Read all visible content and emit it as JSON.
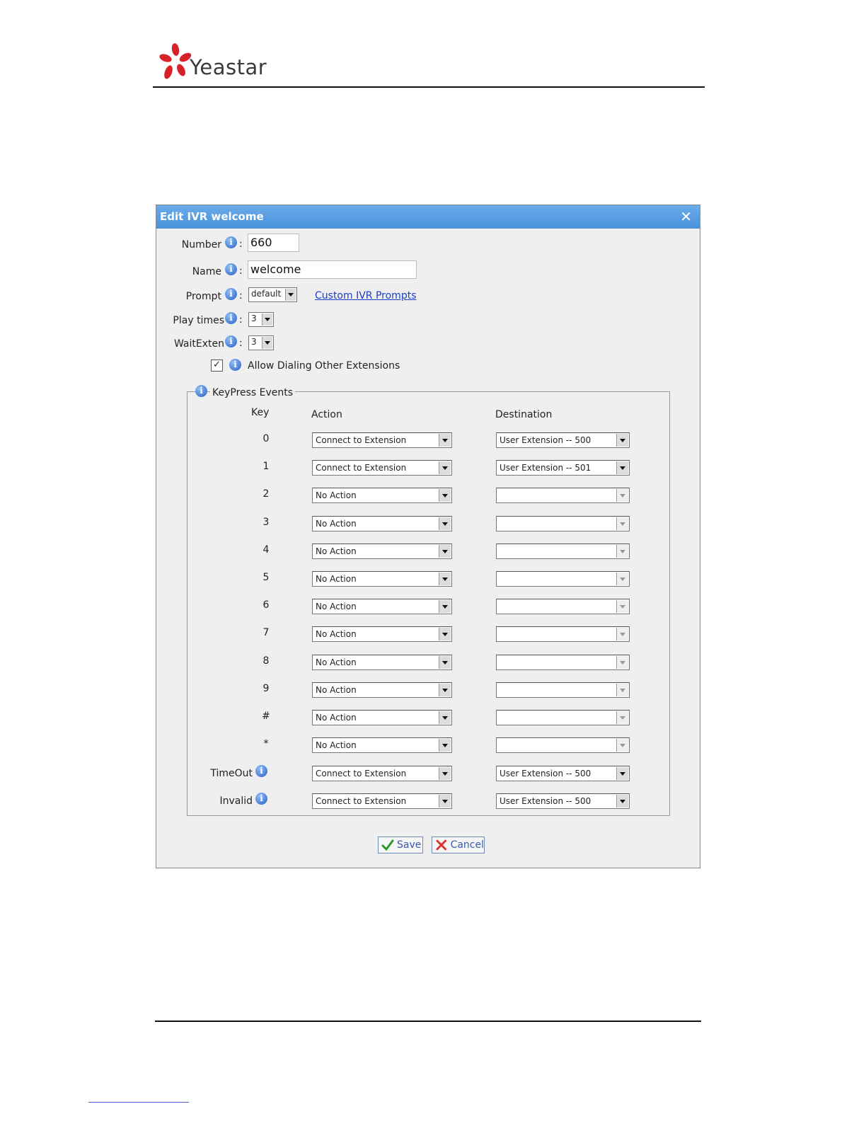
{
  "brand": {
    "name": "Yeastar"
  },
  "dialog": {
    "title": "Edit IVR welcome",
    "close_label": "✕",
    "number": {
      "label": "Number",
      "value": "660"
    },
    "name": {
      "label": "Name",
      "value": "welcome"
    },
    "prompt": {
      "label": "Prompt",
      "value": "default",
      "link": "Custom IVR Prompts"
    },
    "play_times": {
      "label": "Play times",
      "value": "3"
    },
    "wait_exten": {
      "label": "WaitExten",
      "value": "3"
    },
    "allow_dialing": {
      "label": "Allow Dialing Other Extensions",
      "checked": true,
      "mark": "✓"
    },
    "colon": ":",
    "keypress": {
      "legend": "KeyPress Events",
      "headers": {
        "key": "Key",
        "action": "Action",
        "destination": "Destination"
      },
      "rows": [
        {
          "key": "0",
          "action": "Connect to Extension",
          "destination": "User Extension -- 500"
        },
        {
          "key": "1",
          "action": "Connect to Extension",
          "destination": "User Extension -- 501"
        },
        {
          "key": "2",
          "action": "No Action",
          "destination": ""
        },
        {
          "key": "3",
          "action": "No Action",
          "destination": ""
        },
        {
          "key": "4",
          "action": "No Action",
          "destination": ""
        },
        {
          "key": "5",
          "action": "No Action",
          "destination": ""
        },
        {
          "key": "6",
          "action": "No Action",
          "destination": ""
        },
        {
          "key": "7",
          "action": "No Action",
          "destination": ""
        },
        {
          "key": "8",
          "action": "No Action",
          "destination": ""
        },
        {
          "key": "9",
          "action": "No Action",
          "destination": ""
        },
        {
          "key": "#",
          "action": "No Action",
          "destination": ""
        },
        {
          "key": "*",
          "action": "No Action",
          "destination": ""
        }
      ],
      "timeout": {
        "label": "TimeOut",
        "action": "Connect to Extension",
        "destination": "User Extension -- 500"
      },
      "invalid": {
        "label": "Invalid",
        "action": "Connect to Extension",
        "destination": "User Extension -- 500"
      }
    },
    "buttons": {
      "save": "Save",
      "cancel": "Cancel"
    }
  },
  "info_glyph": "i",
  "colors": {
    "titlebar": "#4a92dc",
    "link": "#1a3ec8",
    "dialog_bg": "#efefef"
  }
}
